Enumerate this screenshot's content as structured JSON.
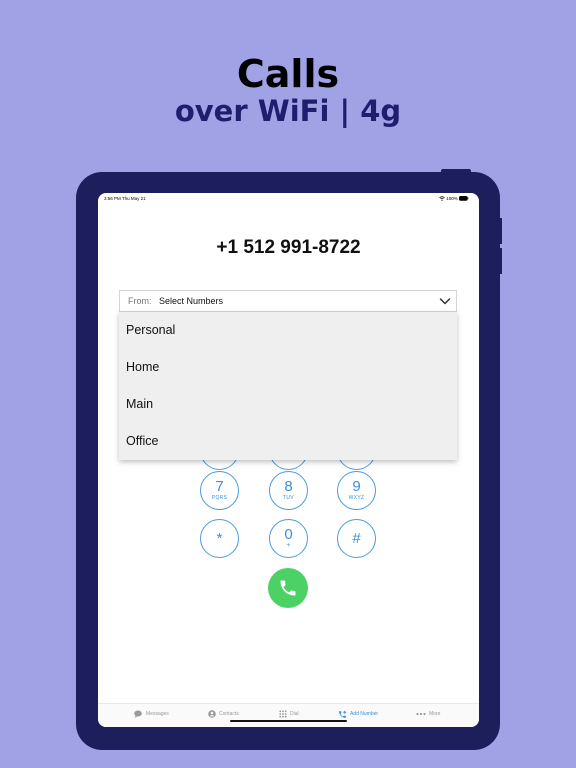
{
  "promo": {
    "headline": "Calls",
    "subheadline": "over WiFi | 4g"
  },
  "status_bar": {
    "time_date": "3:56 PM  Thu May 21",
    "battery": "100%"
  },
  "dialer": {
    "phone_number": "+1 512 991-8722",
    "from_select": {
      "prefix": "From:",
      "value": "Select Numbers",
      "options": [
        "Personal",
        "Home",
        "Main",
        "Office"
      ]
    },
    "keys": [
      {
        "digit": "7",
        "letters": "PQRS"
      },
      {
        "digit": "8",
        "letters": "TUV"
      },
      {
        "digit": "9",
        "letters": "WXYZ"
      },
      {
        "digit": "*",
        "letters": ""
      },
      {
        "digit": "0",
        "letters": "+"
      },
      {
        "digit": "#",
        "letters": ""
      }
    ]
  },
  "tab_bar": {
    "tabs": [
      {
        "label": "Messages",
        "icon": "messages-icon"
      },
      {
        "label": "Contacts",
        "icon": "contacts-icon"
      },
      {
        "label": "Dial",
        "icon": "dialpad-icon"
      },
      {
        "label": "Add Number",
        "icon": "add-number-icon"
      },
      {
        "label": "More",
        "icon": "more-icon"
      }
    ],
    "active_tab": "Add Number"
  },
  "colors": {
    "background": "#a1a2e6",
    "tablet_frame": "#1d1e5c",
    "accent_blue": "#3d8fdb",
    "call_green": "#4cd264"
  }
}
